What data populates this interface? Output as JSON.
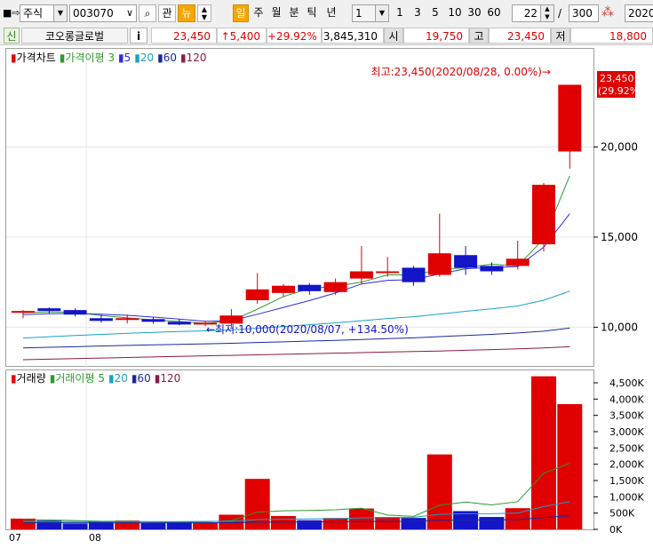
{
  "toolbar": {
    "market_type": "주식",
    "stock_code": "003070",
    "btn_interest": "관",
    "btn_news": "뉴",
    "period_buttons": [
      "일",
      "주",
      "월",
      "분",
      "틱",
      "년"
    ],
    "period_value": "1",
    "quick_buttons": [
      "1",
      "3",
      "5",
      "10",
      "30",
      "60"
    ],
    "bar_count": "22",
    "bar_total": "300",
    "date_value": "2020/"
  },
  "quote": {
    "badge": "신",
    "stock_name": "코오롱글로벌",
    "info_button": "i",
    "price": "23,450",
    "change": "↑5,400",
    "change_pct": "+29.92%",
    "volume": "3,845,310",
    "open_label": "시",
    "open": "19,750",
    "high_label": "고",
    "high": "23,450",
    "low_label": "저",
    "low": "18,800"
  },
  "price_panel": {
    "legend": [
      {
        "text": "가격차트",
        "color": "#000000"
      },
      {
        "text": "가격이평 3",
        "color": "#2f9a2f"
      },
      {
        "text": "5",
        "color": "#2d2de0"
      },
      {
        "text": "20",
        "color": "#1aa0c8"
      },
      {
        "text": "60",
        "color": "#1a2a9a"
      },
      {
        "text": "120",
        "color": "#8b1a4a"
      }
    ],
    "high_annotation": "최고:23,450(2020/08/28, 0.00%)→",
    "low_annotation": "←최저:10,000(2020/08/07, +134.50%)",
    "current_price_label": "23,450",
    "current_pct_label": "(29.92%)",
    "y_ticks": [
      "20,000",
      "15,000",
      "10,000"
    ]
  },
  "volume_panel": {
    "legend": [
      {
        "text": "거래량",
        "color": "#000000"
      },
      {
        "text": "거래이평 5",
        "color": "#2f9a2f"
      },
      {
        "text": "20",
        "color": "#1aa0c8"
      },
      {
        "text": "60",
        "color": "#1a2a9a"
      },
      {
        "text": "120",
        "color": "#8b1a4a"
      }
    ],
    "y_ticks": [
      "4,500K",
      "4,000K",
      "3,500K",
      "3,000K",
      "2,500K",
      "2,000K",
      "1,500K",
      "1,000K",
      "500K",
      "0K"
    ]
  },
  "x_labels": [
    "07",
    "08"
  ],
  "colors": {
    "up": "#e00000",
    "down": "#1414c8"
  },
  "chart_data": {
    "type": "candlestick",
    "price_ylim": [
      8000,
      25000
    ],
    "volume_ylim": [
      0,
      4800
    ],
    "volume_unit": "K",
    "candles": [
      {
        "o": 10900,
        "h": 10950,
        "l": 10500,
        "c": 10900,
        "v": 330
      },
      {
        "o": 11050,
        "h": 11100,
        "l": 10750,
        "c": 10900,
        "v": 270
      },
      {
        "o": 10950,
        "h": 11050,
        "l": 10600,
        "c": 10700,
        "v": 180
      },
      {
        "o": 10500,
        "h": 10700,
        "l": 10250,
        "c": 10350,
        "v": 240
      },
      {
        "o": 10450,
        "h": 10700,
        "l": 10200,
        "c": 10500,
        "v": 270
      },
      {
        "o": 10450,
        "h": 10550,
        "l": 10200,
        "c": 10300,
        "v": 200
      },
      {
        "o": 10300,
        "h": 10450,
        "l": 10100,
        "c": 10150,
        "v": 230
      },
      {
        "o": 10150,
        "h": 10350,
        "l": 10050,
        "c": 10250,
        "v": 210
      },
      {
        "o": 10200,
        "h": 11000,
        "l": 10000,
        "c": 10650,
        "v": 450
      },
      {
        "o": 11500,
        "h": 13000,
        "l": 11300,
        "c": 12100,
        "v": 1550
      },
      {
        "o": 11900,
        "h": 12400,
        "l": 11700,
        "c": 12300,
        "v": 410
      },
      {
        "o": 12350,
        "h": 12450,
        "l": 11800,
        "c": 12000,
        "v": 280
      },
      {
        "o": 11950,
        "h": 12700,
        "l": 11800,
        "c": 12500,
        "v": 350
      },
      {
        "o": 12700,
        "h": 14500,
        "l": 12400,
        "c": 13100,
        "v": 640
      },
      {
        "o": 13100,
        "h": 13900,
        "l": 12800,
        "c": 13100,
        "v": 380
      },
      {
        "o": 13300,
        "h": 13400,
        "l": 12300,
        "c": 12500,
        "v": 350
      },
      {
        "o": 12900,
        "h": 16300,
        "l": 12800,
        "c": 14100,
        "v": 2300
      },
      {
        "o": 14000,
        "h": 14500,
        "l": 12900,
        "c": 13300,
        "v": 560
      },
      {
        "o": 13400,
        "h": 13600,
        "l": 12900,
        "c": 13100,
        "v": 380
      },
      {
        "o": 13400,
        "h": 14800,
        "l": 13200,
        "c": 13800,
        "v": 650
      },
      {
        "o": 14600,
        "h": 18000,
        "l": 14200,
        "c": 17900,
        "v": 4700
      },
      {
        "o": 19750,
        "h": 23450,
        "l": 18800,
        "c": 23450,
        "v": 3845
      }
    ],
    "ma_price": {
      "ma3": [
        10800,
        10850,
        10830,
        10650,
        10520,
        10400,
        10320,
        10220,
        10350,
        11000,
        11700,
        12150,
        12270,
        12500,
        12900,
        12900,
        13200,
        13300,
        13500,
        13400,
        14900,
        18400
      ],
      "ma5": [
        10700,
        10750,
        10760,
        10720,
        10660,
        10560,
        10450,
        10330,
        10360,
        10720,
        11100,
        11480,
        11900,
        12400,
        12600,
        12640,
        12960,
        13240,
        13320,
        13360,
        14440,
        16300
      ],
      "ma20": [
        9400,
        9470,
        9540,
        9600,
        9660,
        9710,
        9760,
        9800,
        9850,
        9940,
        10040,
        10140,
        10240,
        10360,
        10480,
        10580,
        10730,
        10880,
        11020,
        11180,
        11500,
        12000
      ],
      "ma60": [
        8850,
        8890,
        8920,
        8960,
        8990,
        9020,
        9050,
        9080,
        9110,
        9150,
        9190,
        9230,
        9270,
        9320,
        9370,
        9410,
        9480,
        9540,
        9600,
        9680,
        9780,
        9950
      ],
      "ma120": [
        8200,
        8230,
        8260,
        8290,
        8320,
        8350,
        8380,
        8410,
        8440,
        8470,
        8500,
        8530,
        8560,
        8590,
        8620,
        8650,
        8680,
        8720,
        8760,
        8800,
        8850,
        8920
      ]
    },
    "ma_volume": {
      "ma5": [
        300,
        290,
        270,
        250,
        250,
        230,
        220,
        230,
        270,
        530,
        570,
        580,
        600,
        650,
        440,
        400,
        740,
        840,
        750,
        850,
        1720,
        2030
      ],
      "ma20": [
        240,
        240,
        240,
        240,
        240,
        240,
        240,
        245,
        250,
        300,
        310,
        320,
        330,
        350,
        360,
        370,
        460,
        480,
        480,
        500,
        700,
        850
      ],
      "ma60": [
        200,
        200,
        200,
        200,
        200,
        200,
        200,
        200,
        205,
        220,
        225,
        230,
        235,
        240,
        245,
        250,
        280,
        290,
        290,
        300,
        360,
        420
      ]
    }
  }
}
